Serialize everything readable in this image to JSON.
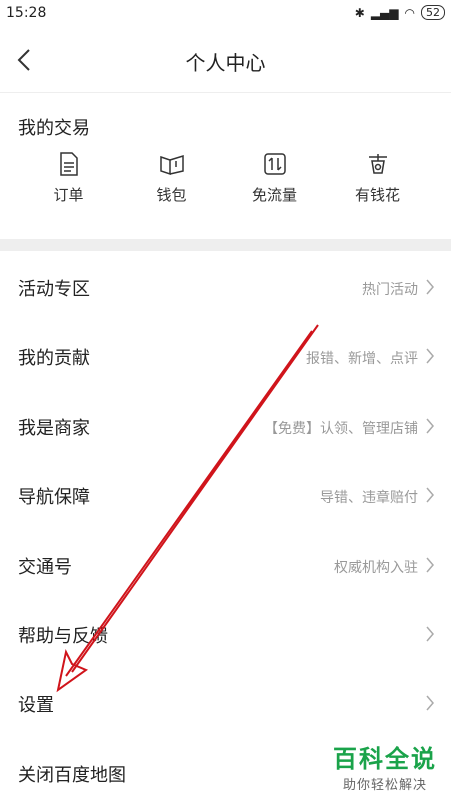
{
  "status_bar": {
    "time": "15:28",
    "battery": "52"
  },
  "header": {
    "title": "个人中心"
  },
  "trade": {
    "title": "我的交易",
    "items": [
      {
        "label": "订单",
        "icon": "document-icon"
      },
      {
        "label": "钱包",
        "icon": "wallet-icon"
      },
      {
        "label": "免流量",
        "icon": "data-swap-icon"
      },
      {
        "label": "有钱花",
        "icon": "money-icon"
      }
    ]
  },
  "menu": [
    {
      "label": "活动专区",
      "hint": "热门活动"
    },
    {
      "label": "我的贡献",
      "hint": "报错、新增、点评"
    },
    {
      "label": "我是商家",
      "hint": "【免费】认领、管理店铺"
    },
    {
      "label": "导航保障",
      "hint": "导错、违章赔付"
    },
    {
      "label": "交通号",
      "hint": "权威机构入驻"
    },
    {
      "label": "帮助与反馈",
      "hint": ""
    },
    {
      "label": "设置",
      "hint": ""
    },
    {
      "label": "关闭百度地图",
      "hint": ""
    }
  ],
  "watermark": {
    "main": "百科全说",
    "sub": "助你轻松解决"
  },
  "colors": {
    "annotation": "#d0141b",
    "watermark": "#1aa34a"
  }
}
